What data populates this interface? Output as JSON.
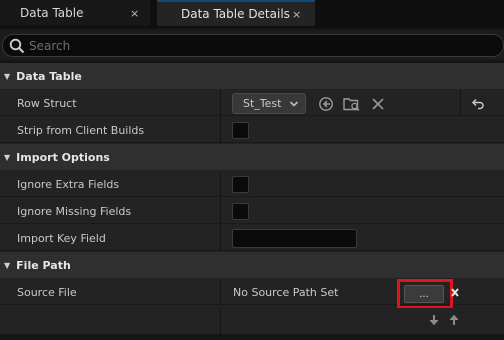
{
  "tabs": [
    {
      "label": "Data Table",
      "close": "×"
    },
    {
      "label": "Data Table Details",
      "close": "×"
    }
  ],
  "search": {
    "placeholder": "Search"
  },
  "categories": {
    "data_table": "Data Table",
    "import_options": "Import Options",
    "file_path": "File Path"
  },
  "rows": {
    "row_struct": {
      "label": "Row Struct",
      "value": "St_Test"
    },
    "strip_from_client_builds": {
      "label": "Strip from Client Builds",
      "checked": false
    },
    "ignore_extra_fields": {
      "label": "Ignore Extra Fields",
      "checked": false
    },
    "ignore_missing_fields": {
      "label": "Ignore Missing Fields",
      "checked": false
    },
    "import_key_field": {
      "label": "Import Key Field",
      "value": ""
    },
    "source_file": {
      "label": "Source File",
      "value": "No Source Path Set",
      "browse_label": "..."
    }
  },
  "icons": {
    "search": "search-icon",
    "chevron": "chevron-down-icon",
    "use_selected": "use-selected-icon",
    "browse": "browse-folder-icon",
    "clear": "clear-icon",
    "reset": "reset-to-default-icon",
    "close_small": "close-icon",
    "arrow_down": "arrow-down-icon",
    "arrow_up": "arrow-up-icon"
  },
  "colors": {
    "highlight": "#e0141e",
    "tab_accent": "#0d4a80"
  }
}
